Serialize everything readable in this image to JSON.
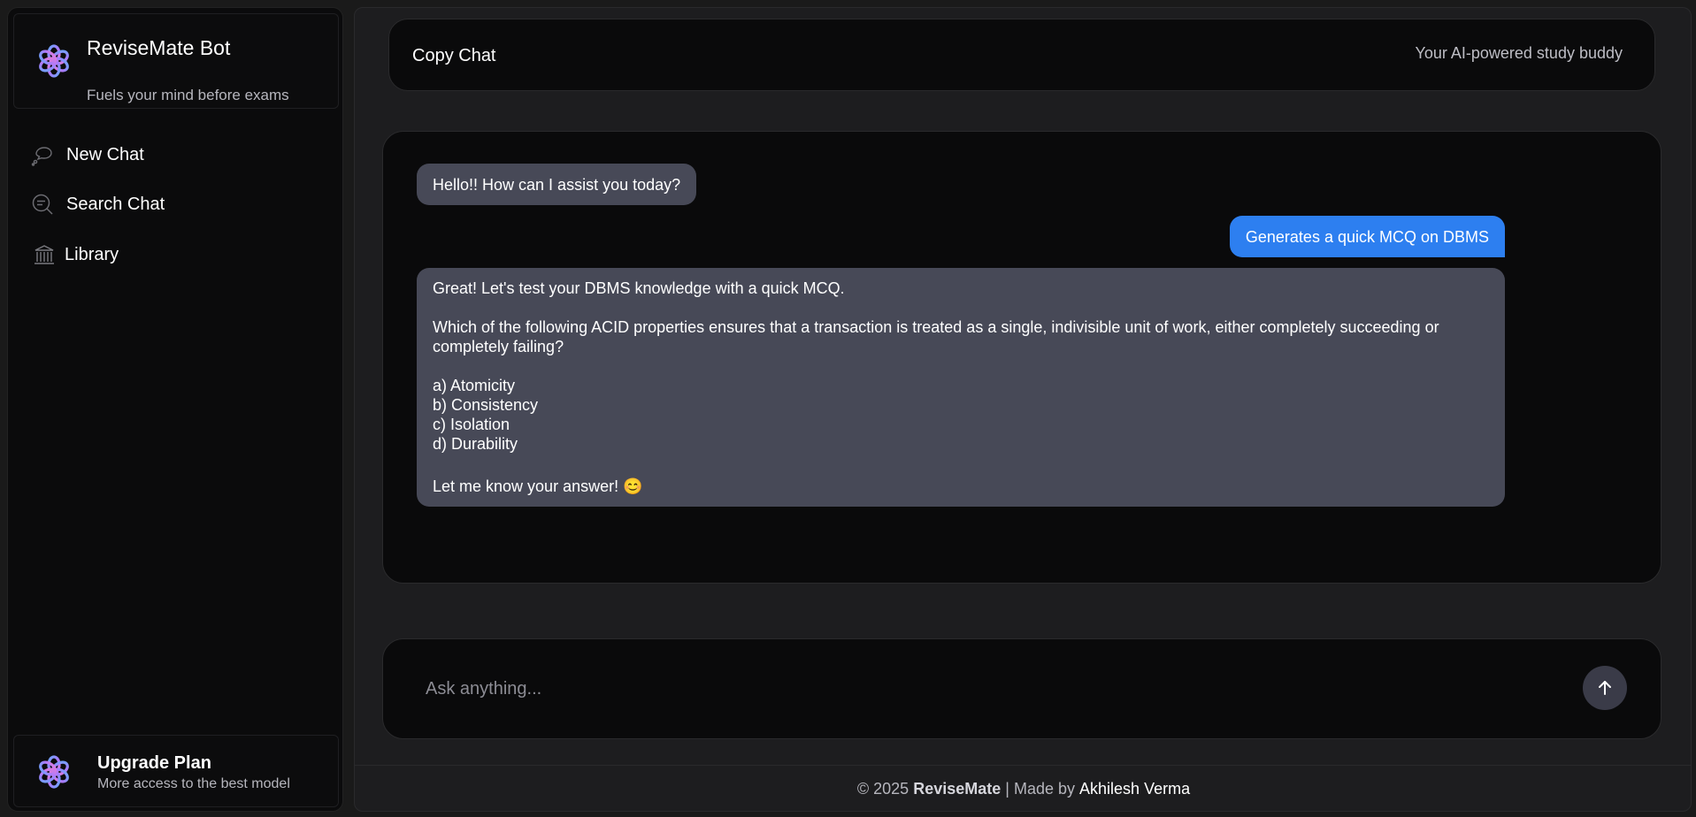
{
  "sidebar": {
    "brand": {
      "title": "ReviseMate Bot",
      "subtitle": "Fuels your mind before exams",
      "logo_icon": "flower-swirl-logo-icon"
    },
    "nav": {
      "new_chat": "New Chat",
      "search_chat": "Search Chat",
      "library": "Library"
    },
    "upgrade": {
      "title": "Upgrade Plan",
      "subtitle": "More access to the best model"
    }
  },
  "header": {
    "copy_chat": "Copy Chat",
    "tagline": "Your AI-powered study buddy"
  },
  "messages": {
    "greeting": "Hello!! How can I assist you today?",
    "user_prompt": "Generates a quick MCQ on DBMS",
    "answer": {
      "intro": "Great! Let's test your DBMS knowledge with a quick MCQ.",
      "question": "Which of the following ACID properties ensures that a transaction is treated as a single, indivisible unit of work, either completely succeeding or completely failing?",
      "option_a": "a) Atomicity",
      "option_b": "b) Consistency",
      "option_c": "c) Isolation",
      "option_d": "d) Durability",
      "closing": "Let me know your answer! 😊"
    }
  },
  "composer": {
    "placeholder": "Ask anything..."
  },
  "footer": {
    "copyright": "© 2025",
    "brand": "ReviseMate",
    "made_by": "| Made by",
    "author": "Akhilesh Verma"
  },
  "colors": {
    "accent": "#2d7ff0",
    "bot_bubble": "#474957",
    "panel": "#0a0a0b",
    "background": "#1d1d1f"
  }
}
